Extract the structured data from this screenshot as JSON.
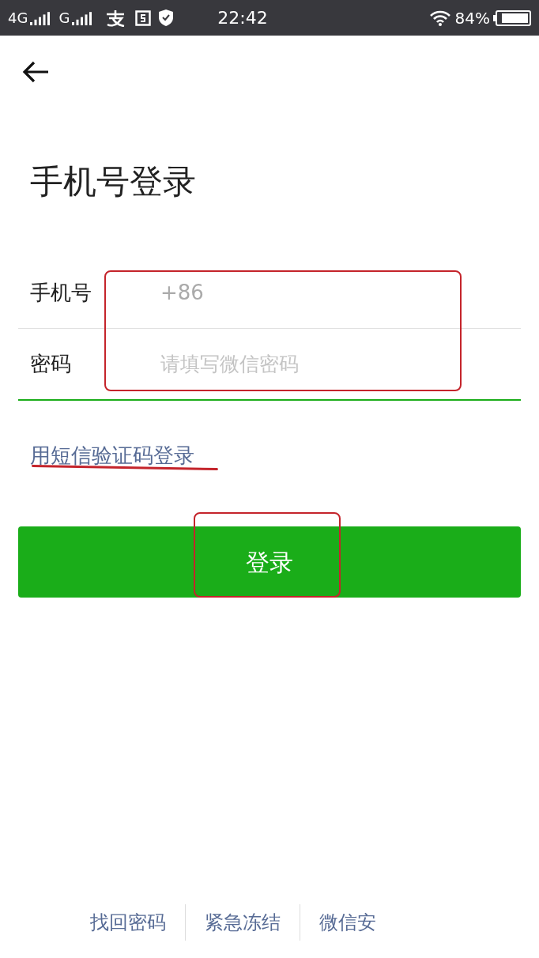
{
  "status_bar": {
    "network_1": "4G",
    "network_2": "G",
    "time": "22:42",
    "battery": "84%"
  },
  "title": "手机号登录",
  "fields": [
    {
      "label": "手机号",
      "value": "+86",
      "kind": "value"
    },
    {
      "label": "密码",
      "placeholder": "请填写微信密码",
      "kind": "password"
    }
  ],
  "sms_login_link": "用短信验证码登录",
  "login_button": "登录",
  "footer_links": [
    "找回密码",
    "紧急冻结",
    "微信安"
  ]
}
